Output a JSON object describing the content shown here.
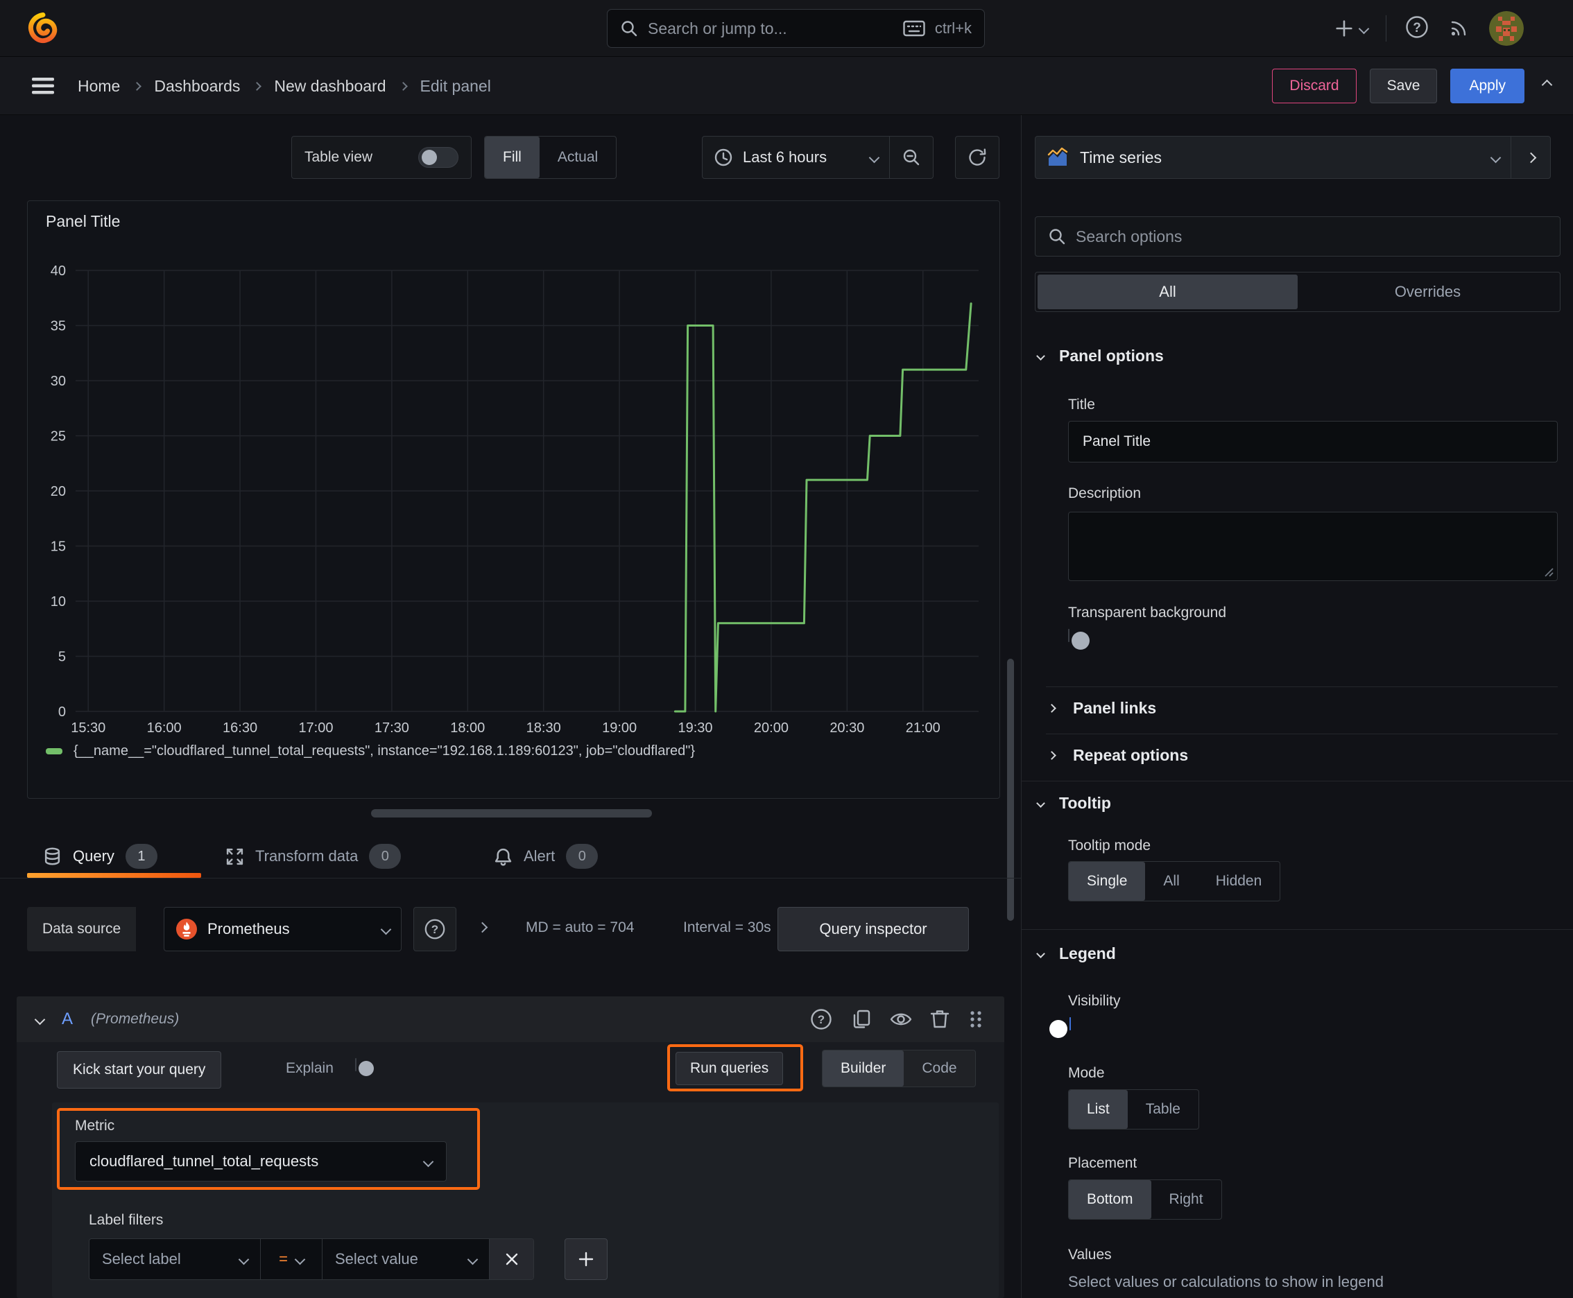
{
  "topnav": {
    "search_placeholder": "Search or jump to...",
    "shortcut": "ctrl+k"
  },
  "breadcrumb": {
    "items": [
      "Home",
      "Dashboards",
      "New dashboard",
      "Edit panel"
    ]
  },
  "actions": {
    "discard": "Discard",
    "save": "Save",
    "apply": "Apply"
  },
  "toolbar": {
    "table_view": "Table view",
    "fill": "Fill",
    "actual": "Actual",
    "time_range": "Last 6 hours"
  },
  "panel": {
    "title": "Panel Title",
    "legend": "{__name__=\"cloudflared_tunnel_total_requests\", instance=\"192.168.1.189:60123\", job=\"cloudflared\"}"
  },
  "chart_data": {
    "type": "line",
    "title": "Panel Title",
    "x_start": "15:30",
    "x_domain_minutes": [
      -5,
      352
    ],
    "x_tick_step_minutes": 30,
    "x_ticks": [
      "15:30",
      "16:00",
      "16:30",
      "17:00",
      "17:30",
      "18:00",
      "18:30",
      "19:00",
      "19:30",
      "20:00",
      "20:30",
      "21:00"
    ],
    "y_ticks": [
      0,
      5,
      10,
      15,
      20,
      25,
      30,
      35,
      40
    ],
    "ylim": [
      0,
      40
    ],
    "grid": true,
    "legend_position": "bottom",
    "line_color": "#73BF69",
    "series": [
      {
        "name": "{__name__=\"cloudflared_tunnel_total_requests\", instance=\"192.168.1.189:60123\", job=\"cloudflared\"}",
        "color": "#73BF69",
        "points": [
          [
            "19:22",
            0
          ],
          [
            "19:26",
            0
          ],
          [
            "19:27",
            35
          ],
          [
            "19:37",
            35
          ],
          [
            "19:38",
            0
          ],
          [
            "19:39",
            8
          ],
          [
            "20:13",
            8
          ],
          [
            "20:14",
            21
          ],
          [
            "20:38",
            21
          ],
          [
            "20:39",
            25
          ],
          [
            "20:51",
            25
          ],
          [
            "20:52",
            31
          ],
          [
            "21:17",
            31
          ],
          [
            "21:19",
            37
          ]
        ]
      }
    ]
  },
  "tabs": {
    "query": "Query",
    "query_count": "1",
    "transform": "Transform data",
    "transform_count": "0",
    "alert": "Alert",
    "alert_count": "0"
  },
  "datasource": {
    "label": "Data source",
    "name": "Prometheus",
    "md": "MD = auto = 704",
    "interval": "Interval = 30s",
    "inspector": "Query inspector"
  },
  "query": {
    "ref": "A",
    "hint": "(Prometheus)",
    "kick_start": "Kick start your query",
    "explain": "Explain",
    "run": "Run queries",
    "builder": "Builder",
    "code": "Code",
    "metric_label": "Metric",
    "metric_value": "cloudflared_tunnel_total_requests",
    "filters_label": "Label filters",
    "select_label": "Select label",
    "op": "=",
    "select_value": "Select value"
  },
  "sidebar": {
    "viz": "Time series",
    "search_placeholder": "Search options",
    "tabs": {
      "all": "All",
      "overrides": "Overrides"
    },
    "panel_options": {
      "header": "Panel options",
      "title_label": "Title",
      "title_value": "Panel Title",
      "description_label": "Description",
      "transparent_label": "Transparent background"
    },
    "links_header": "Panel links",
    "repeat_header": "Repeat options",
    "tooltip": {
      "header": "Tooltip",
      "mode_label": "Tooltip mode",
      "modes": [
        "Single",
        "All",
        "Hidden"
      ]
    },
    "legend": {
      "header": "Legend",
      "visibility_label": "Visibility",
      "mode_label": "Mode",
      "modes": [
        "List",
        "Table"
      ],
      "placement_label": "Placement",
      "placements": [
        "Bottom",
        "Right"
      ],
      "values_label": "Values",
      "values_hint": "Select values or calculations to show in legend"
    }
  }
}
